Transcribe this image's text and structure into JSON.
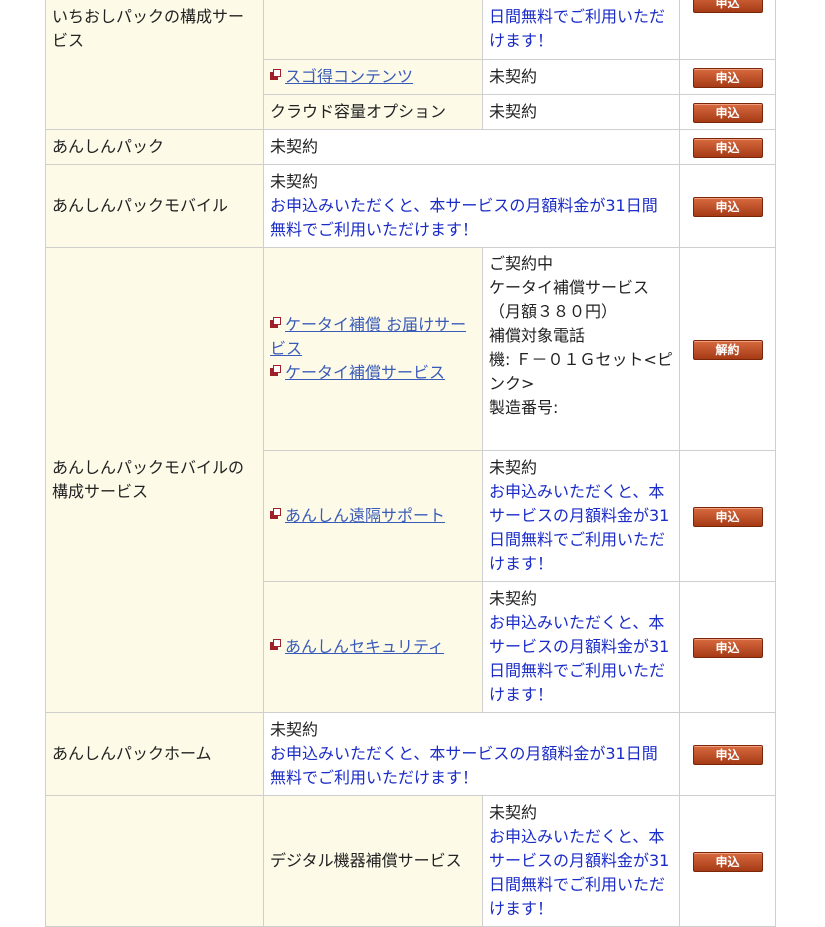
{
  "rows": {
    "ichioshi": {
      "label": "いちおしパックの構成サービス",
      "top": {
        "msg": "日間無料でご利用いただけます！",
        "button": "申込"
      },
      "sugotoku": {
        "link": "スゴ得コンテンツ",
        "status": "未契約",
        "button": "申込"
      },
      "cloud": {
        "name": "クラウド容量オプション",
        "status": "未契約",
        "button": "申込"
      }
    },
    "anshin_pack": {
      "label": "あんしんパック",
      "status": "未契約",
      "button": "申込"
    },
    "anshin_mobile": {
      "label": "あんしんパックモバイル",
      "status": "未契約",
      "msg": "お申込みいただくと、本サービスの月額料金が31日間無料でご利用いただけます！",
      "button": "申込"
    },
    "mobile_components": {
      "label": "あんしんパックモバイルの構成サービス",
      "keitai": {
        "link1": "ケータイ補償 お届けサービス",
        "link2": "ケータイ補償サービス",
        "status_lines": [
          "ご契約中",
          "ケータイ補償サービス",
          "（月額３８０円）",
          "補償対象電話",
          "機: Ｆ－０１Ｇセット<ピンク>",
          "製造番号:"
        ],
        "button": "解約"
      },
      "remote": {
        "link": "あんしん遠隔サポート",
        "status": "未契約",
        "msg": "お申込みいただくと、本サービスの月額料金が31日間無料でご利用いただけます！",
        "button": "申込"
      },
      "security": {
        "link": "あんしんセキュリティ",
        "status": "未契約",
        "msg": "お申込みいただくと、本サービスの月額料金が31日間無料でご利用いただけます！",
        "button": "申込"
      }
    },
    "anshin_home": {
      "label": "あんしんパックホーム",
      "status": "未契約",
      "msg": "お申込みいただくと、本サービスの月額料金が31日間無料でご利用いただけます！",
      "button": "申込"
    },
    "digital": {
      "name": "デジタル機器補償サービス",
      "status": "未契約",
      "msg": "お申込みいただくと、本サービスの月額料金が31日間無料でご利用いただけます！",
      "button": "申込"
    }
  }
}
